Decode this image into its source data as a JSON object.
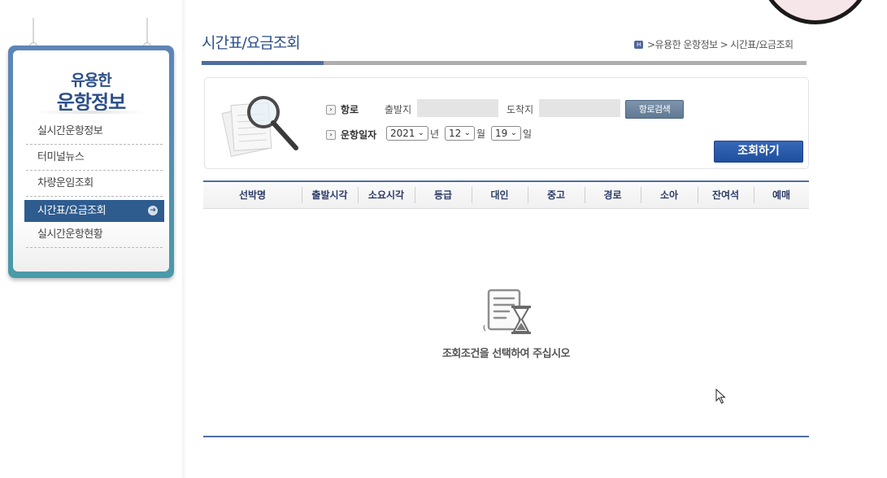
{
  "sidebar": {
    "title_line1": "유용한",
    "title_line2": "운항정보",
    "items": [
      {
        "label": "실시간운항정보"
      },
      {
        "label": "터미널뉴스"
      },
      {
        "label": "차량운임조회"
      },
      {
        "label": "시간표/요금조회",
        "active": true
      },
      {
        "label": "실시간운항현황"
      }
    ]
  },
  "header": {
    "title": "시간표/요금조회",
    "breadcrumb": [
      ">유용한 운항정보",
      ">",
      "시간표/요금조회"
    ]
  },
  "search": {
    "route_label": "항로",
    "departure_label": "출발지",
    "departure_value": "",
    "arrival_label": "도착지",
    "arrival_value": "",
    "route_search_button": "항로검색",
    "date_label": "운항일자",
    "year": "2021",
    "year_unit": "년",
    "month": "12",
    "month_unit": "월",
    "day": "19",
    "day_unit": "일",
    "query_button": "조회하기"
  },
  "table": {
    "columns": [
      "선박명",
      "출발시각",
      "소요시각",
      "등급",
      "대인",
      "중고",
      "경로",
      "소아",
      "잔여석",
      "예매"
    ]
  },
  "empty": {
    "message": "조회조건을 선택하여 주십시오"
  },
  "colors": {
    "brand": "#2c4f8a",
    "accent_bar": "#4f6ea0",
    "active_menu": "#2e5c8e",
    "query_button": "#2a5aab"
  }
}
